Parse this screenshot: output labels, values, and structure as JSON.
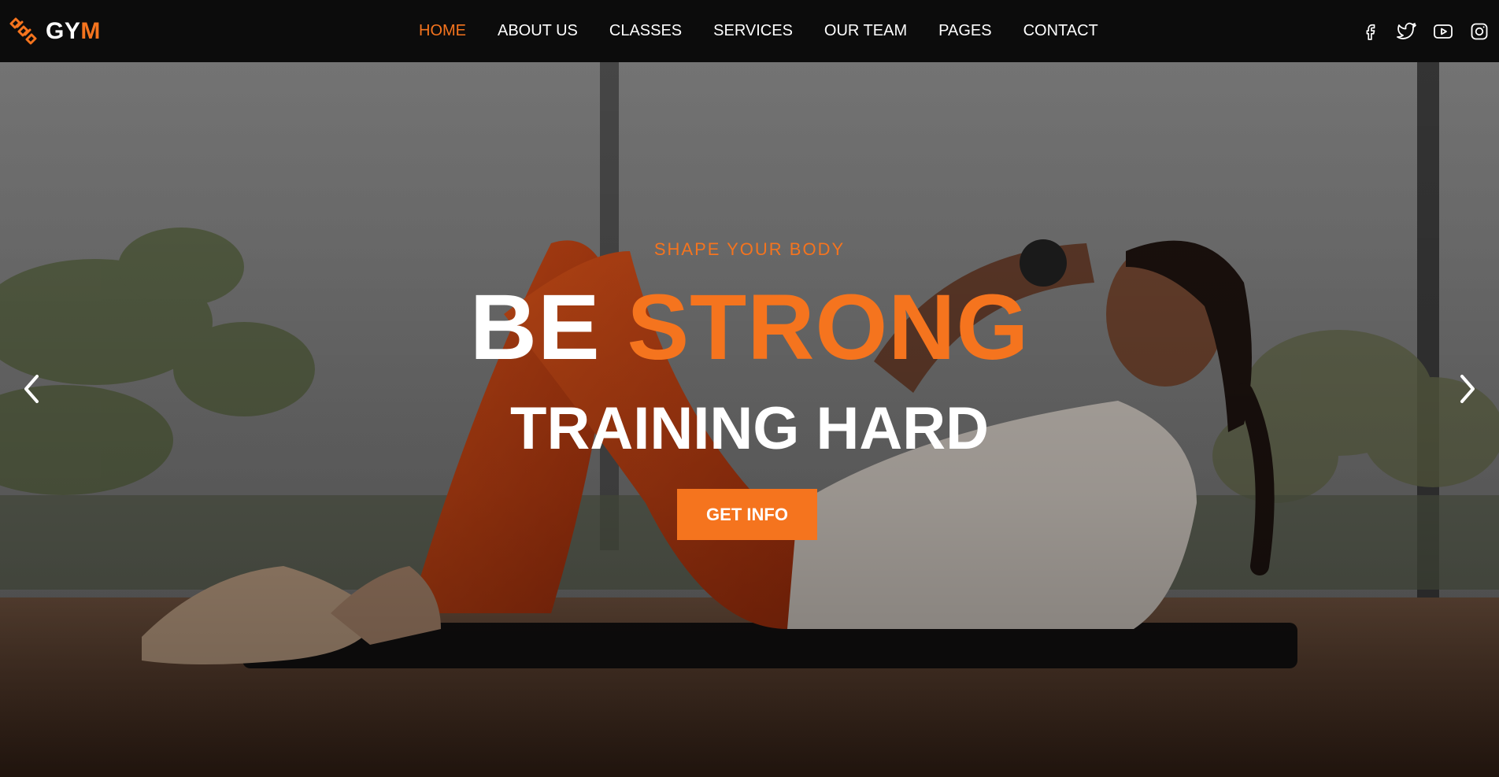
{
  "brand": {
    "name_main": "GY",
    "name_accent": "M",
    "logo_icon": "dumbbell-chain-icon"
  },
  "nav": {
    "items": [
      {
        "label": "HOME",
        "active": true
      },
      {
        "label": "ABOUT US",
        "active": false
      },
      {
        "label": "CLASSES",
        "active": false
      },
      {
        "label": "SERVICES",
        "active": false
      },
      {
        "label": "OUR TEAM",
        "active": false
      },
      {
        "label": "PAGES",
        "active": false
      },
      {
        "label": "CONTACT",
        "active": false
      }
    ]
  },
  "socials": [
    "facebook-icon",
    "twitter-icon",
    "youtube-icon",
    "instagram-icon"
  ],
  "hero": {
    "kicker": "SHAPE YOUR BODY",
    "title_plain": "BE ",
    "title_accent": "STRONG",
    "subtitle": "TRAINING HARD",
    "cta_label": "GET INFO",
    "prev_icon": "chevron-left-icon",
    "next_icon": "chevron-right-icon"
  },
  "colors": {
    "accent": "#f5741e",
    "header_bg": "#0c0c0c",
    "text": "#ffffff"
  }
}
